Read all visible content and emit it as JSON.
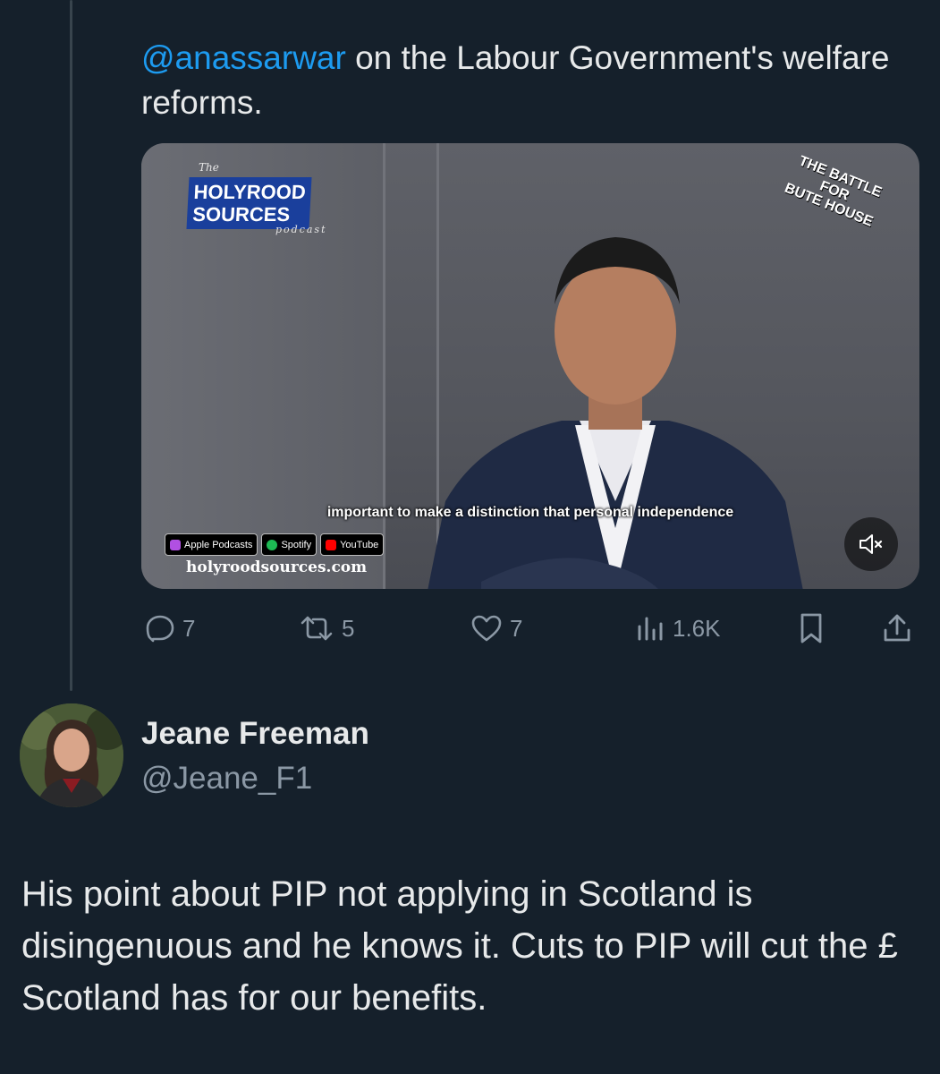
{
  "tweet": {
    "mention": "@anassarwar",
    "text": " on the Labour Government's welfare reforms."
  },
  "media": {
    "logo_the": "The",
    "logo_line1": "HOLYROOD",
    "logo_line2": "SOURCES",
    "logo_podcast": "podcast",
    "battle_line1": "THE BATTLE",
    "battle_line2": "FOR",
    "battle_line3": "BUTE HOUSE",
    "caption": "important to make a distinction that personal independence",
    "badges": [
      {
        "label": "Apple Podcasts",
        "color": "#b150e2"
      },
      {
        "label": "Spotify",
        "color": "#1db954"
      },
      {
        "label": "YouTube",
        "color": "#ff0000"
      }
    ],
    "site": "holyroodsources.com",
    "mute_icon": "volume-muted-icon"
  },
  "actions": {
    "replies": "7",
    "reposts": "5",
    "likes": "7",
    "views": "1.6K"
  },
  "reply": {
    "name": "Jeane Freeman",
    "handle": "@Jeane_F1",
    "text": "His point about PIP not applying in Scotland is disingenuous and he knows it. Cuts to PIP will cut the £ Scotland has for our benefits."
  },
  "colors": {
    "background": "#15202b",
    "accent": "#1d9bf0",
    "muted_text": "#8b98a5"
  }
}
